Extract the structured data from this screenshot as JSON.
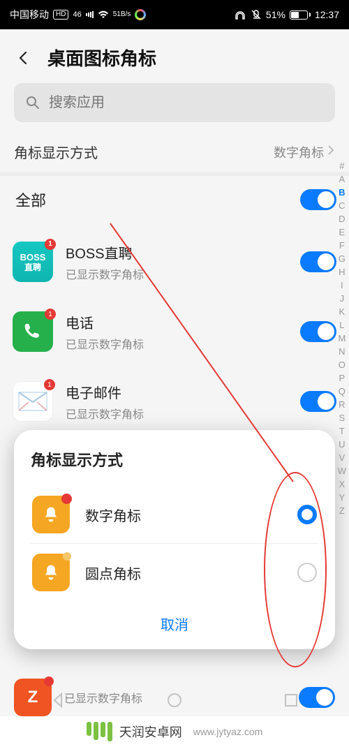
{
  "status": {
    "carrier": "中国移动",
    "net_badge": "HD",
    "net_gen": "46",
    "speed_top": "51",
    "speed_bottom": "B/s",
    "battery_pct": "51%",
    "time": "12:37"
  },
  "header": {
    "title": "桌面图标角标"
  },
  "search": {
    "placeholder": "搜索应用"
  },
  "mode_row": {
    "label": "角标显示方式",
    "value": "数字角标"
  },
  "all_row": {
    "label": "全部"
  },
  "apps": [
    {
      "name": "BOSS直聘",
      "sub": "已显示数字角标",
      "icon_line1": "BOSS",
      "icon_line2": "直聘"
    },
    {
      "name": "电话",
      "sub": "已显示数字角标"
    },
    {
      "name": "电子邮件",
      "sub": "已显示数字角标"
    }
  ],
  "peek": {
    "sub": "已显示数字角标"
  },
  "alphabet": [
    "#",
    "A",
    "B",
    "C",
    "D",
    "E",
    "F",
    "G",
    "H",
    "I",
    "J",
    "K",
    "L",
    "M",
    "N",
    "O",
    "P",
    "Q",
    "R",
    "S",
    "T",
    "U",
    "V",
    "W",
    "X",
    "Y",
    "Z"
  ],
  "alphabet_active": "B",
  "modal": {
    "title": "角标显示方式",
    "options": [
      {
        "label": "数字角标",
        "selected": true,
        "style": "numeric"
      },
      {
        "label": "圆点角标",
        "selected": false,
        "style": "dot"
      }
    ],
    "cancel": "取消"
  },
  "watermark": {
    "brand": "天润安卓网",
    "url": "www.jytyaz.com"
  }
}
